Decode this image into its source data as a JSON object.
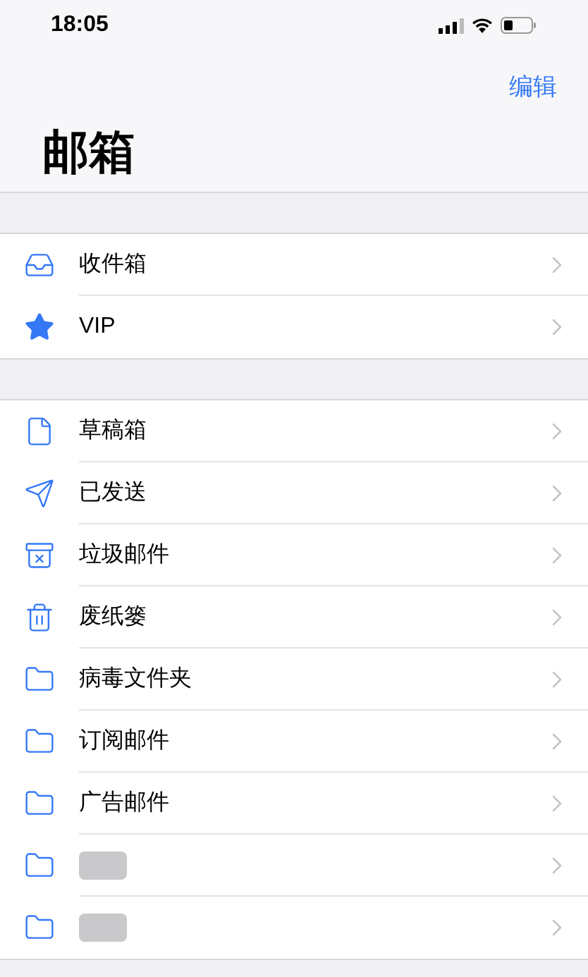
{
  "status_bar": {
    "time": "18:05"
  },
  "nav": {
    "edit": "编辑",
    "title": "邮箱"
  },
  "sections": [
    {
      "items": [
        {
          "kind": "inbox",
          "label": "收件箱",
          "redacted": false
        },
        {
          "kind": "vip",
          "label": "VIP",
          "redacted": false
        }
      ]
    },
    {
      "items": [
        {
          "kind": "drafts",
          "label": "草稿箱",
          "redacted": false
        },
        {
          "kind": "sent",
          "label": "已发送",
          "redacted": false
        },
        {
          "kind": "junk",
          "label": "垃圾邮件",
          "redacted": false
        },
        {
          "kind": "trash",
          "label": "废纸篓",
          "redacted": false
        },
        {
          "kind": "folder",
          "label": "病毒文件夹",
          "redacted": false
        },
        {
          "kind": "folder",
          "label": "订阅邮件",
          "redacted": false
        },
        {
          "kind": "folder",
          "label": "广告邮件",
          "redacted": false
        },
        {
          "kind": "folder",
          "redacted": true
        },
        {
          "kind": "folder",
          "redacted": true
        }
      ]
    }
  ]
}
